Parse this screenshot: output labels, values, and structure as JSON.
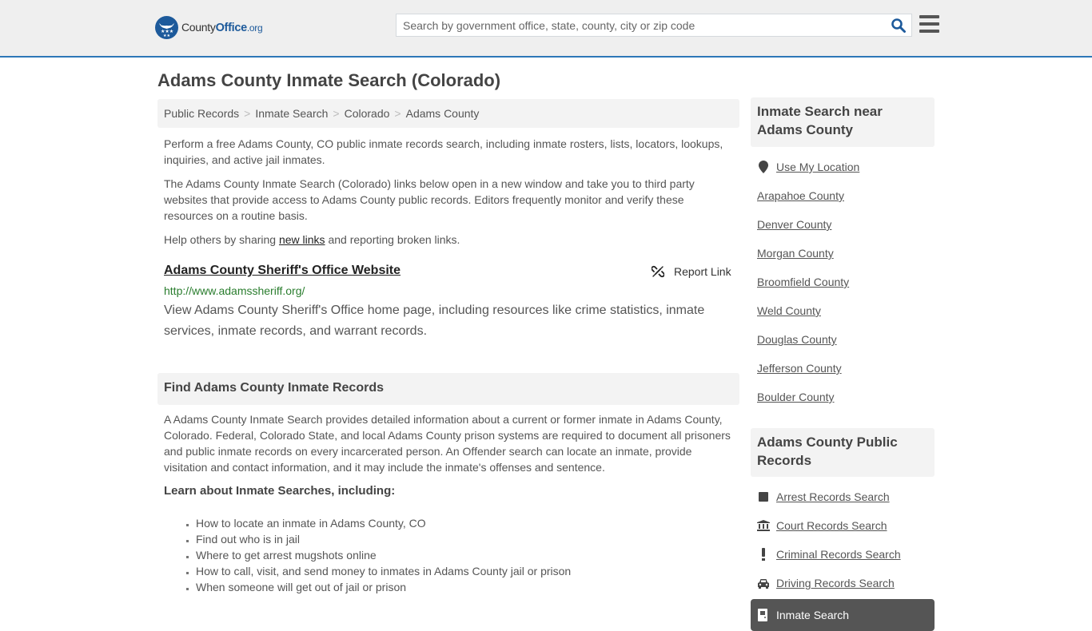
{
  "header": {
    "logo_text_county": "County",
    "logo_text_office": "Office",
    "logo_text_org": ".org",
    "search_placeholder": "Search by government office, state, county, city or zip code",
    "search_value": "",
    "colors": {
      "brand_blue": "#1d5a9b",
      "header_border": "#2e77b8",
      "header_bg": "#efefef"
    }
  },
  "page": {
    "title": "Adams County Inmate Search (Colorado)"
  },
  "breadcrumb": [
    {
      "label": "Public Records"
    },
    {
      "label": "Inmate Search"
    },
    {
      "label": "Colorado"
    },
    {
      "label": "Adams County"
    }
  ],
  "breadcrumb_separator": ">",
  "intro": {
    "p1": "Perform a free Adams County, CO public inmate records search, including inmate rosters, lists, locators, lookups, inquiries, and active jail inmates.",
    "p2": "The Adams County Inmate Search (Colorado) links below open in a new window and take you to third party websites that provide access to Adams County public records. Editors frequently monitor and verify these resources on a routine basis.",
    "p3_before": "Help others by sharing ",
    "p3_link": "new links",
    "p3_after": " and reporting broken links."
  },
  "result": {
    "title": "Adams County Sheriff's Office Website",
    "url": "http://www.adamssheriff.org/",
    "description": "View Adams County Sheriff's Office home page, including resources like crime statistics, inmate services, inmate records, and warrant records.",
    "report_label": "Report Link",
    "url_color": "#2a7d2e"
  },
  "find_section": {
    "heading": "Find Adams County Inmate Records",
    "body": "A Adams County Inmate Search provides detailed information about a current or former inmate in Adams County, Colorado. Federal, Colorado State, and local Adams County prison systems are required to document all prisoners and public inmate records on every incarcerated person. An Offender search can locate an inmate, provide visitation and contact information, and it may include the inmate's offenses and sentence.",
    "learn_heading": "Learn about Inmate Searches, including:",
    "bullets": [
      "How to locate an inmate in Adams County, CO",
      "Find out who is in jail",
      "Where to get arrest mugshots online",
      "How to call, visit, and send money to inmates in Adams County jail or prison",
      "When someone will get out of jail or prison"
    ]
  },
  "sidebar": {
    "nearby_heading": "Inmate Search near Adams County",
    "use_location": "Use My Location",
    "nearby": [
      "Arapahoe County",
      "Denver County",
      "Morgan County",
      "Broomfield County",
      "Weld County",
      "Douglas County",
      "Jefferson County",
      "Boulder County"
    ],
    "records_heading": "Adams County Public Records",
    "records": [
      {
        "label": "Arrest Records Search",
        "icon": "square-icon"
      },
      {
        "label": "Court Records Search",
        "icon": "courthouse-icon"
      },
      {
        "label": "Criminal Records Search",
        "icon": "exclamation-icon"
      },
      {
        "label": "Driving Records Search",
        "icon": "car-icon"
      },
      {
        "label": "Inmate Search",
        "icon": "jail-door-icon",
        "active": true
      }
    ]
  }
}
